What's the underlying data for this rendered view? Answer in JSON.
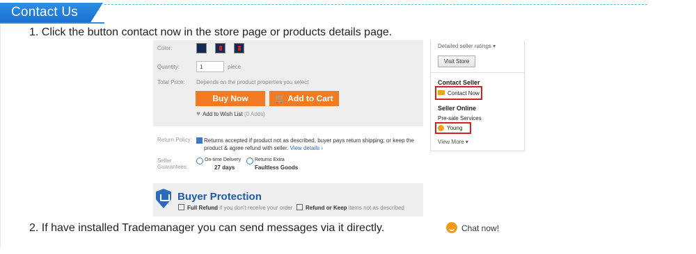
{
  "header": {
    "title": "Contact Us"
  },
  "steps": {
    "step1": "1. Click the button contact now in the store page or products details page.",
    "step2": "2. If have installed Trademanager you can send messages via it directly."
  },
  "product": {
    "color_label": "Color:",
    "quantity_label": "Quantity:",
    "quantity_value": "1",
    "quantity_unit": "piece",
    "total_label": "Total Price:",
    "total_value": "Depends on the product properties you select",
    "buy_now": "Buy Now",
    "add_to_cart": "Add to Cart",
    "wish_text": "Add to Wish List",
    "wish_count": "(0 Adds)",
    "return_label": "Return Policy:",
    "return_text": "Returns accepted if product not as described, buyer pays return shipping; or keep the product & agree refund with seller.",
    "return_link": "View details ›",
    "guarantee_label_1": "Seller",
    "guarantee_label_2": "Guarantees:",
    "delivery_label": "On-time Delivery",
    "delivery_value": "27 days",
    "returns_label": "Returns Extra",
    "returns_value": "Faultless Goods"
  },
  "protection": {
    "title": "Buyer Protection",
    "item1_bold": "Full Refund",
    "item1_rest": "if you don't receive your order",
    "item2_bold": "Refund or Keep",
    "item2_rest": "items not as described"
  },
  "seller": {
    "ratings": "Detailed seller ratings ▾",
    "visit_store": "Visit Store",
    "contact_heading": "Contact Seller",
    "contact_now": "Contact Now",
    "online_heading": "Seller Online",
    "presale": "Pre-sale Services",
    "agent": "Young",
    "view_more": "View More ▾"
  },
  "chat": {
    "label": "Chat now!"
  },
  "colors": {
    "accent": "#2b8fe3",
    "button": "#f27a22",
    "highlight": "#d42020"
  }
}
